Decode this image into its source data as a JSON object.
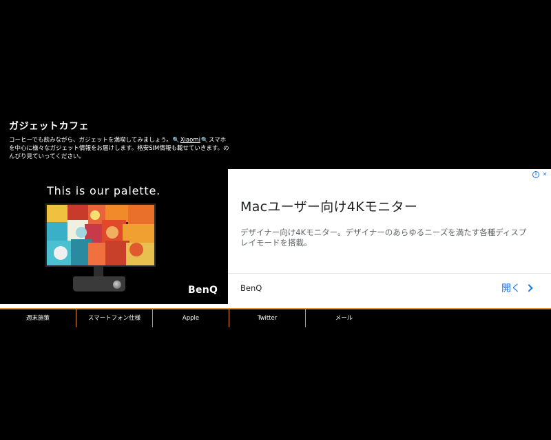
{
  "site": {
    "title": "ガジェットカフェ",
    "description_part1": "コーヒーでも飲みながら、ガジェットを満喫してみましょう。",
    "description_link": "Xiaomi",
    "description_part2": "スマホを中心に様々なガジェット情報をお届けします。格安SIM情報も載せていきます。のんびり見ていってください。"
  },
  "ad": {
    "tagline": "This is our palette.",
    "brand_logo": "BenQ",
    "headline": "Macユーザー向け4Kモニター",
    "body": "デザイナー向け4Kモニター。デザイナーのあらゆるニーズを満たす各種ディスプレイモードを搭載。",
    "advertiser": "BenQ",
    "open_label": "開く",
    "colors": {
      "link": "#1a73e8"
    }
  },
  "nav": {
    "accent_color": "#e8912a",
    "items": [
      {
        "label": "週末施策"
      },
      {
        "label": "スマートフォン仕様"
      },
      {
        "label": "Apple"
      },
      {
        "label": "Twitter"
      },
      {
        "label": "メール"
      }
    ]
  }
}
